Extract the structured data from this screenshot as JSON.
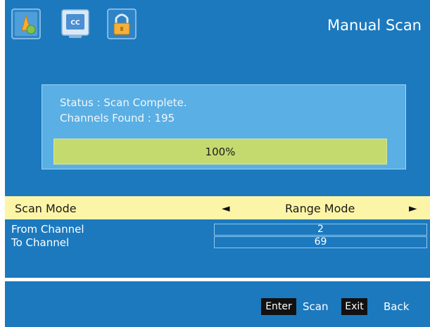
{
  "header": {
    "title": "Manual Scan",
    "icons": [
      "picture-settings-icon",
      "closed-caption-icon",
      "parental-lock-icon"
    ],
    "icon_cc_text": "CC"
  },
  "status": {
    "line1": "Status : Scan Complete.",
    "line2": "Channels Found : 195",
    "progress_text": "100%",
    "progress_value": 1.0
  },
  "settings": {
    "scan_mode": {
      "label": "Scan Mode",
      "value": "Range Mode",
      "left_arrow": "◄",
      "right_arrow": "►"
    },
    "from_channel": {
      "label": "From Channel",
      "value": "2"
    },
    "to_channel": {
      "label": "To Channel",
      "value": "69"
    }
  },
  "footer": {
    "enter_key": "Enter",
    "enter_action": "Scan",
    "exit_key": "Exit",
    "exit_action": "Back"
  },
  "colors": {
    "background": "#1c79be",
    "panel": "#5aafe4",
    "progress": "#c4da6f",
    "highlight": "#fcf5a7"
  }
}
